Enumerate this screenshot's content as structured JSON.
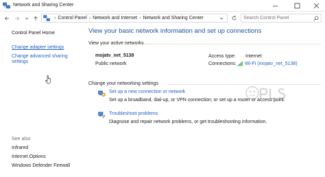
{
  "window": {
    "title": "Network and Sharing Center",
    "icon": "network-center-icon",
    "controls": [
      "minimize-icon",
      "maximize-icon",
      "close-icon"
    ]
  },
  "address": {
    "breadcrumbs": [
      "Control Panel",
      "Network and Internet",
      "Network and Sharing Center"
    ],
    "search_placeholder": "Search Control Panel"
  },
  "sidebar": {
    "home": "Control Panel Home",
    "links": [
      "Change adapter settings",
      "Change advanced sharing settings"
    ],
    "see_also_label": "See also",
    "see_also": [
      "Infrared",
      "Internet Options",
      "Windows Defender Firewall"
    ]
  },
  "main": {
    "heading": "View your basic network information and set up connections",
    "active_networks_label": "View your active networks",
    "network": {
      "name": "mojatv_net_5138",
      "type": "Public network",
      "access_type_label": "Access type:",
      "access_type_value": "Internet",
      "connections_label": "Connections:",
      "connections_value": "Wi-Fi (mojatv_net_5138)"
    },
    "change_settings_label": "Change your networking settings",
    "tasks": [
      {
        "icon": "new-connection-icon",
        "link": "Set up a new connection or network",
        "description": "Set up a broadband, dial-up, or VPN connection; or set up a router or access point."
      },
      {
        "icon": "troubleshoot-icon",
        "link": "Troubleshoot problems",
        "description": "Diagnose and repair network problems, or get troubleshooting information."
      }
    ]
  },
  "colors": {
    "link": "#2160c4",
    "heading": "#1e4e9c"
  }
}
